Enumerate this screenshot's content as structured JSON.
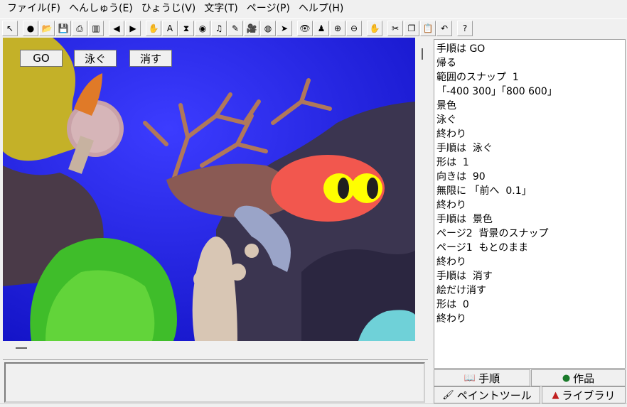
{
  "menu": [
    "ファイル(F)",
    "へんしゅう(E)",
    "ひょうじ(V)",
    "文字(T)",
    "ページ(P)",
    "ヘルプ(H)"
  ],
  "toolbar": [
    {
      "icon": "cursor-arrow-icon",
      "glyph": "↖"
    },
    {
      "icon": "globe-icon",
      "glyph": "●"
    },
    {
      "icon": "open-folder-icon",
      "glyph": "📂"
    },
    {
      "icon": "save-icon",
      "glyph": "💾"
    },
    {
      "icon": "print-icon",
      "glyph": "⎙"
    },
    {
      "icon": "page-layout-icon",
      "glyph": "▥"
    },
    {
      "icon": "back-arrow-icon",
      "glyph": "◀"
    },
    {
      "icon": "forward-arrow-icon",
      "glyph": "▶"
    },
    {
      "icon": "turtle-icon",
      "glyph": "✋"
    },
    {
      "icon": "text-a-icon",
      "glyph": "A"
    },
    {
      "icon": "hourglass-icon",
      "glyph": "⧗"
    },
    {
      "icon": "eye-button-icon",
      "glyph": "◉"
    },
    {
      "icon": "music-note-icon",
      "glyph": "♫"
    },
    {
      "icon": "pen-icon",
      "glyph": "✎"
    },
    {
      "icon": "video-camera-icon",
      "glyph": "🎥"
    },
    {
      "icon": "earth-icon",
      "glyph": "◍"
    },
    {
      "icon": "pointer-icon",
      "glyph": "➤"
    },
    {
      "icon": "eye-icon",
      "glyph": "👁"
    },
    {
      "icon": "stamp-icon",
      "glyph": "♟"
    },
    {
      "icon": "zoom-in-icon",
      "glyph": "⊕"
    },
    {
      "icon": "zoom-out-icon",
      "glyph": "⊖"
    },
    {
      "icon": "stop-hand-icon",
      "glyph": "✋"
    },
    {
      "icon": "cut-icon",
      "glyph": "✂"
    },
    {
      "icon": "copy-icon",
      "glyph": "❐"
    },
    {
      "icon": "paste-icon",
      "glyph": "📋"
    },
    {
      "icon": "undo-icon",
      "glyph": "↶"
    },
    {
      "icon": "help-icon",
      "glyph": "?"
    }
  ],
  "stage_buttons": [
    "GO",
    "泳ぐ",
    "消す"
  ],
  "script": [
    "手順は GO",
    "帰る",
    "範囲のスナップ  1",
    "「-400 300」「800 600」",
    "景色",
    "泳ぐ",
    "終わり",
    "手順は  泳ぐ",
    "形は  1",
    "向きは  90",
    "無限に 「前へ  0.1」",
    "終わり",
    "手順は  景色",
    "ページ2  背景のスナップ",
    "ページ1  もとのまま",
    "終わり",
    "手順は  消す",
    "絵だけ消す",
    "形は  0",
    "終わり"
  ],
  "tabs": {
    "procedure": "手順",
    "work": "作品",
    "paint_tool": "ペイントツール",
    "library": "ライブラリ"
  },
  "colors": {
    "water": "#1f26e6",
    "fish_body": "#f2574e",
    "fish_eye": "#ffff00"
  }
}
